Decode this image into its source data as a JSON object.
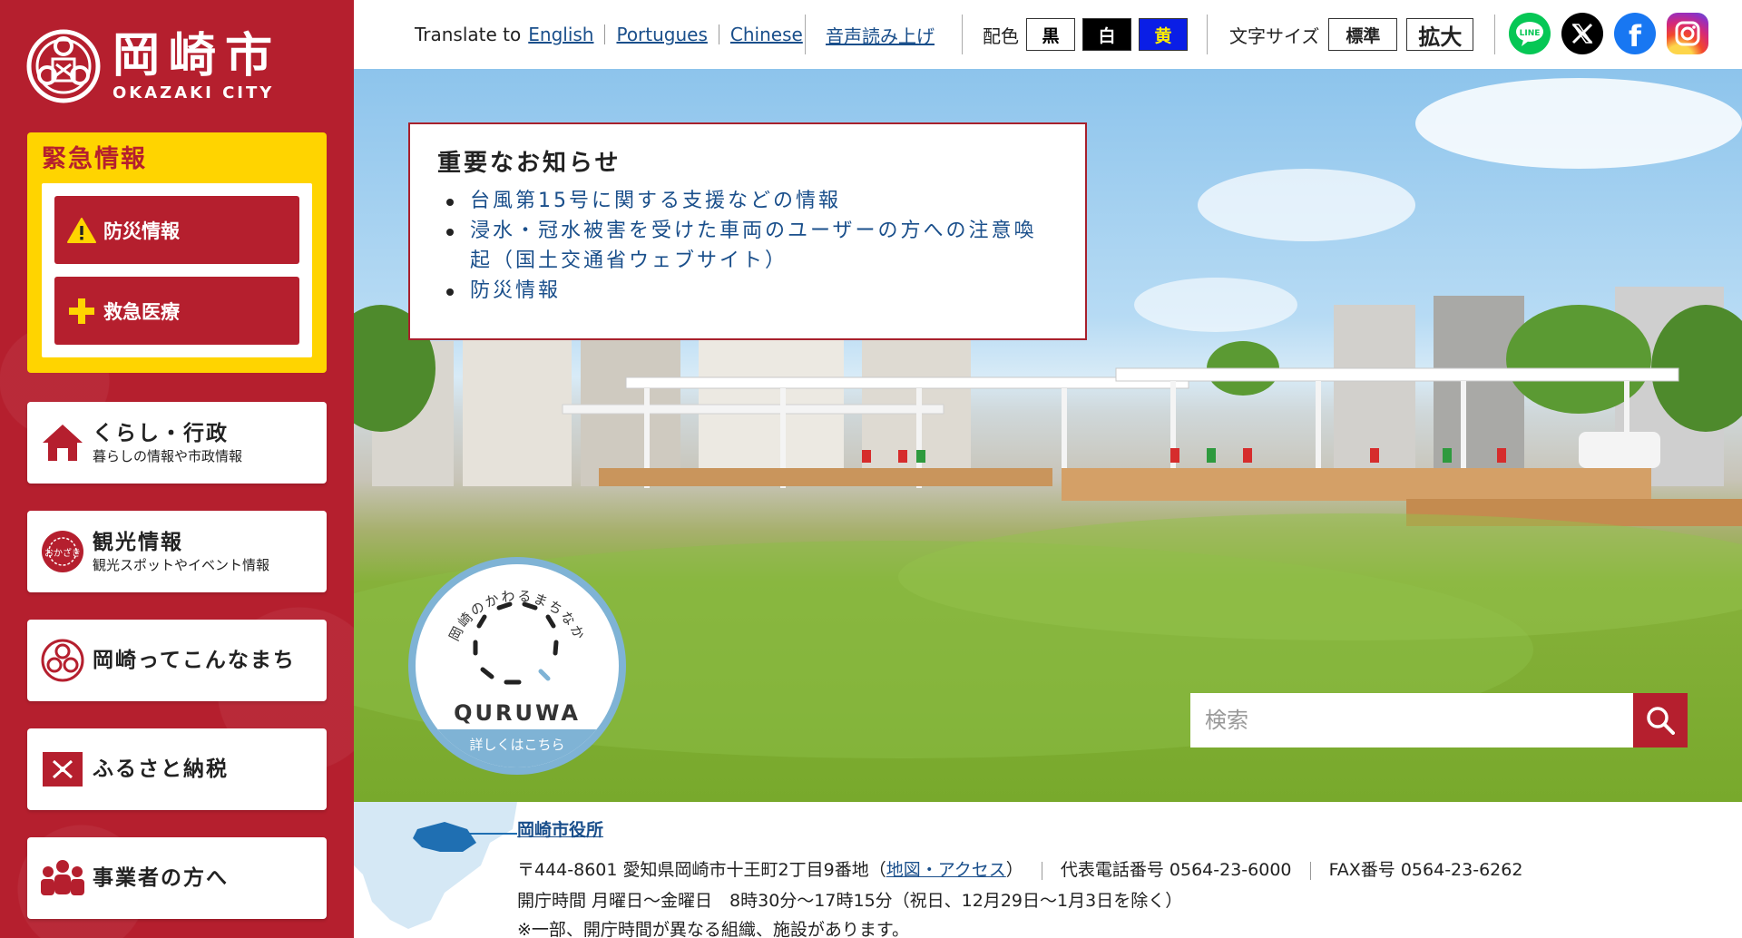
{
  "site": {
    "name_ja": "岡崎市",
    "name_en": "OKAZAKI CITY"
  },
  "emergency": {
    "title": "緊急情報",
    "items": [
      {
        "label": "防災情報",
        "icon": "warning-icon"
      },
      {
        "label": "救急医療",
        "icon": "plus-icon"
      }
    ]
  },
  "nav": [
    {
      "title": "くらし・行政",
      "sub": "暮らしの情報や市政情報",
      "icon": "house-icon"
    },
    {
      "title": "観光情報",
      "sub": "観光スポットやイベント情報",
      "icon": "okazaki-tourism-icon",
      "icon_text": "おかざき"
    },
    {
      "title": "岡崎ってこんなまち",
      "sub": "",
      "icon": "city-emblem-icon"
    },
    {
      "title": "ふるさと納税",
      "sub": "",
      "icon": "gift-icon"
    },
    {
      "title": "事業者の方へ",
      "sub": "",
      "icon": "people-icon"
    }
  ],
  "topbar": {
    "translate_label": "Translate to",
    "languages": [
      "English",
      "Portugues",
      "Chinese"
    ],
    "read_aloud": "音声読み上げ",
    "color_label": "配色",
    "colors": [
      {
        "label": "黒",
        "bg": "#ffffff",
        "fg": "#000000"
      },
      {
        "label": "白",
        "bg": "#000000",
        "fg": "#ffffff"
      },
      {
        "label": "黄",
        "bg": "#0a1ee6",
        "fg": "#ffee00"
      }
    ],
    "font_size_label": "文字サイズ",
    "font_sizes": [
      "標準",
      "拡大"
    ],
    "sns": [
      {
        "name": "line-icon",
        "color": "#06c755",
        "text": "LINE"
      },
      {
        "name": "x-icon",
        "color": "#000000",
        "text": "𝕏"
      },
      {
        "name": "facebook-icon",
        "color": "#1877f2",
        "text": "f"
      },
      {
        "name": "instagram-icon",
        "color": "#e1306c",
        "text": ""
      }
    ]
  },
  "notice": {
    "title": "重要なお知らせ",
    "items": [
      "台風第15号に関する支援などの情報",
      "浸水・冠水被害を受けた車両のユーザーの方への注意喚起（国土交通省ウェブサイト）",
      "防災情報"
    ]
  },
  "quruwa": {
    "ring_text": "岡崎のかわるまちなか",
    "name": "QURUWA",
    "more": "詳しくはこちら"
  },
  "search": {
    "placeholder": "検索"
  },
  "footer": {
    "office_name": "岡崎市役所",
    "address_prefix": "〒444-8601 愛知県岡崎市十王町2丁目9番地（",
    "address_link": "地図・アクセス",
    "address_suffix": "）",
    "phone": "代表電話番号 0564-23-6000",
    "fax": "FAX番号 0564-23-6262",
    "hours": "開庁時間 月曜日～金曜日　8時30分～17時15分（祝日、12月29日～1月3日を除く）",
    "note": "※一部、開庁時間が異なる組織、施設があります。"
  },
  "colors": {
    "brand_red": "#b51f2e",
    "emergency_yellow": "#ffd400",
    "link_blue": "#1a4f8b"
  }
}
